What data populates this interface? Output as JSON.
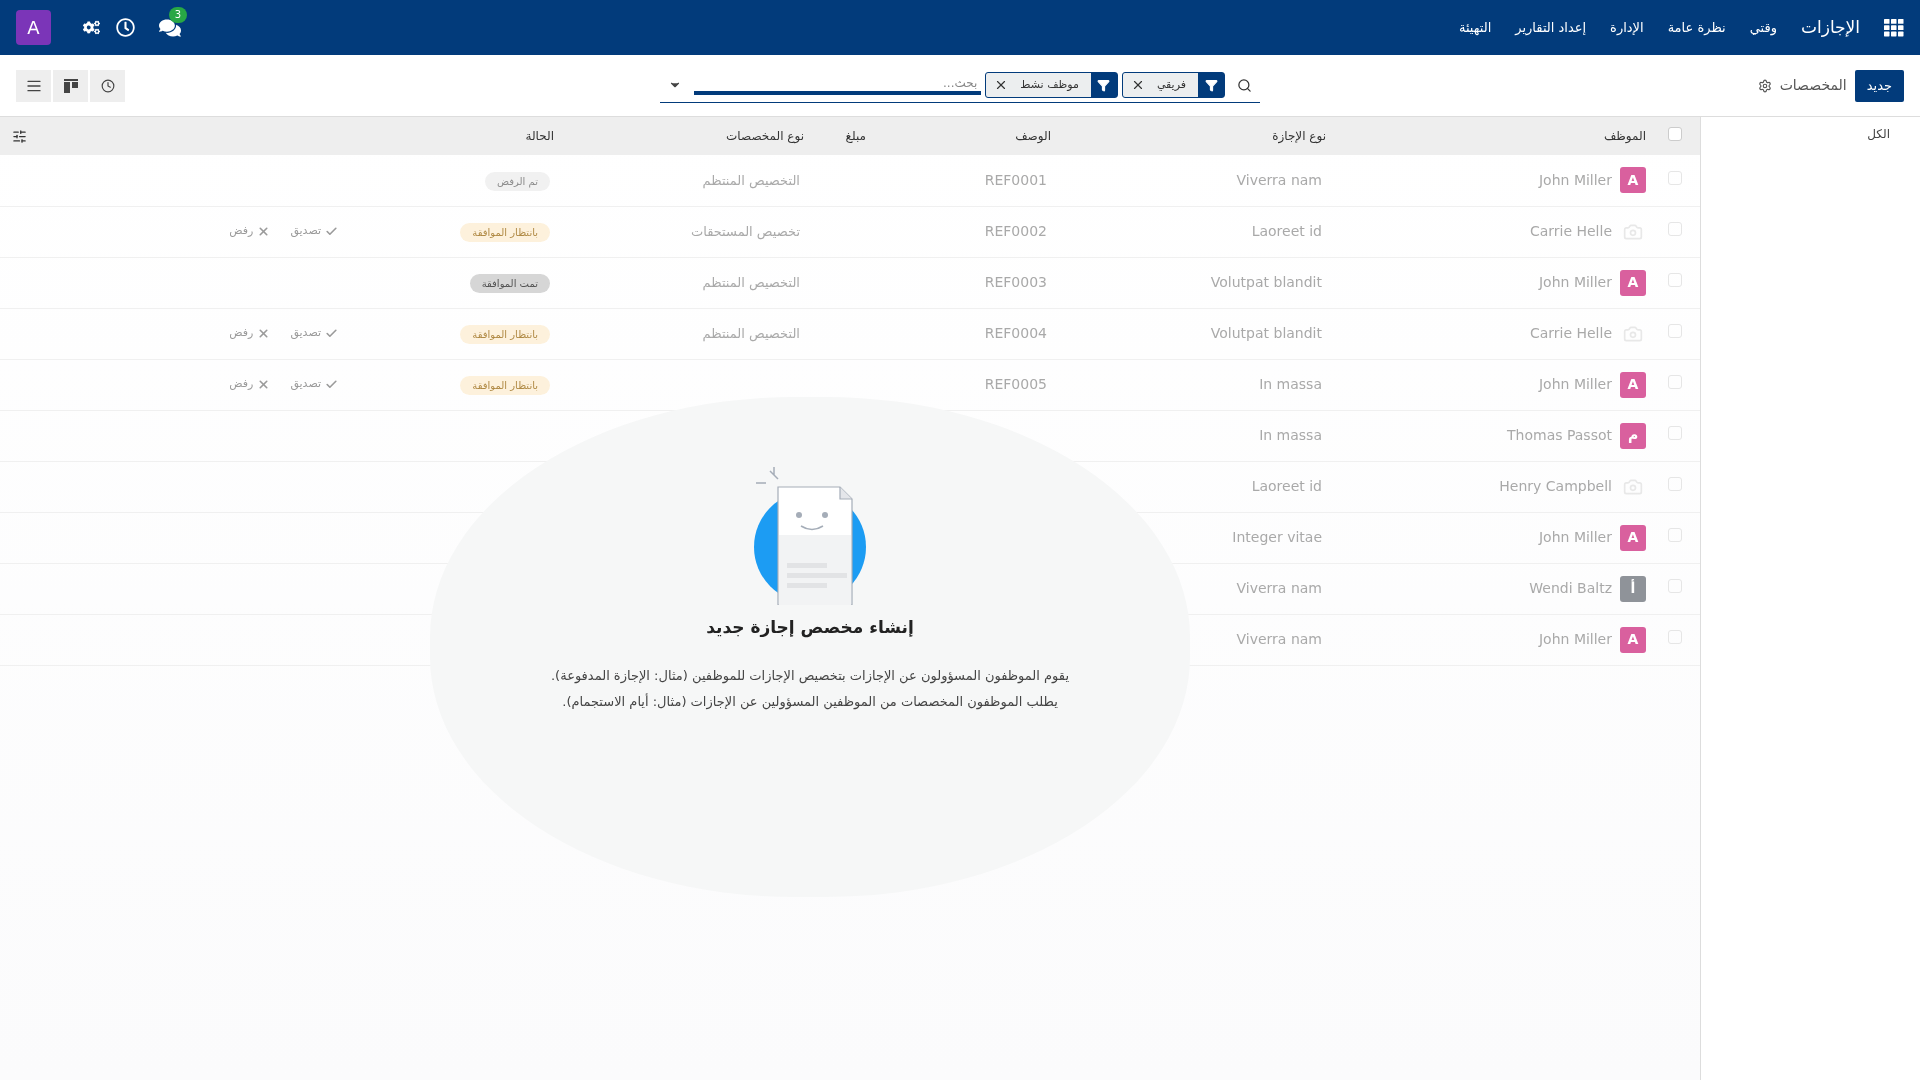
{
  "navbar": {
    "brand": "الإجازات",
    "menu": [
      "وقتي",
      "نظرة عامة",
      "الإدارة",
      "إعداد التقارير",
      "التهيئة"
    ],
    "messages_badge": "3",
    "user_avatar": "A"
  },
  "control_panel": {
    "new_button": "جديد",
    "breadcrumb": "المخصصات",
    "search": {
      "facets": [
        {
          "kind": "filter",
          "label": "فريقي"
        },
        {
          "kind": "filter",
          "label": "موظف نشط"
        }
      ],
      "placeholder": "بحث..."
    }
  },
  "sidebar": {
    "items": [
      {
        "label": "الكل"
      }
    ]
  },
  "table": {
    "columns": [
      "الموظف",
      "نوع الإجازة",
      "الوصف",
      "مبلغ",
      "نوع المخصصات",
      "الحالة"
    ],
    "select_all_checked": false,
    "rows": [
      {
        "checked": false,
        "employee": "John Miller",
        "avatar": {
          "kind": "letter",
          "letter": "A",
          "color": "#d9609e"
        },
        "leave_type": "Viverra nam",
        "description": "REF0001",
        "allocation_type": "التخصيص المنتظم",
        "status": {
          "kind": "refused",
          "label": "تم الرفض"
        },
        "actions": []
      },
      {
        "checked": false,
        "employee": "Carrie Helle",
        "avatar": {
          "kind": "camera"
        },
        "leave_type": "Laoreet id",
        "description": "REF0002",
        "allocation_type": "تخصيص المستحقات",
        "status": {
          "kind": "waiting",
          "label": "بانتظار الموافقة"
        },
        "actions": [
          {
            "kind": "approve",
            "label": "تصديق"
          },
          {
            "kind": "refuse",
            "label": "رفض"
          }
        ]
      },
      {
        "checked": false,
        "employee": "John Miller",
        "avatar": {
          "kind": "letter",
          "letter": "A",
          "color": "#d9609e"
        },
        "leave_type": "Volutpat blandit",
        "description": "REF0003",
        "allocation_type": "التخصيص المنتظم",
        "status": {
          "kind": "approved",
          "label": "تمت الموافقة"
        },
        "actions": []
      },
      {
        "checked": false,
        "employee": "Carrie Helle",
        "avatar": {
          "kind": "camera"
        },
        "leave_type": "Volutpat blandit",
        "description": "REF0004",
        "allocation_type": "التخصيص المنتظم",
        "status": {
          "kind": "waiting",
          "label": "بانتظار الموافقة"
        },
        "actions": [
          {
            "kind": "approve",
            "label": "تصديق"
          },
          {
            "kind": "refuse",
            "label": "رفض"
          }
        ]
      },
      {
        "checked": false,
        "employee": "John Miller",
        "avatar": {
          "kind": "letter",
          "letter": "A",
          "color": "#d9609e"
        },
        "leave_type": "In massa",
        "description": "REF0005",
        "status": {
          "kind": "waiting",
          "label": "بانتظار الموافقة"
        },
        "actions": [
          {
            "kind": "approve",
            "label": "تصديق"
          },
          {
            "kind": "refuse",
            "label": "رفض"
          }
        ]
      },
      {
        "checked": false,
        "employee": "Thomas Passot",
        "avatar": {
          "kind": "letter",
          "letter": "م",
          "color": "#d9609e"
        },
        "leave_type": "In massa",
        "actions": []
      },
      {
        "checked": false,
        "employee": "Henry Campbell",
        "avatar": {
          "kind": "camera"
        },
        "leave_type": "Laoreet id",
        "actions": []
      },
      {
        "checked": false,
        "employee": "John Miller",
        "avatar": {
          "kind": "letter",
          "letter": "A",
          "color": "#d9609e"
        },
        "leave_type": "Integer vitae",
        "actions": []
      },
      {
        "checked": false,
        "employee": "Wendi Baltz",
        "avatar": {
          "kind": "letter",
          "letter": "أ",
          "color": "#8f9399"
        },
        "leave_type": "Viverra nam",
        "actions": []
      },
      {
        "checked": false,
        "employee": "John Miller",
        "avatar": {
          "kind": "letter",
          "letter": "A",
          "color": "#d9609e"
        },
        "leave_type": "Viverra nam",
        "actions": []
      }
    ]
  },
  "empty_state": {
    "title": "إنشاء مخصص إجازة جديد",
    "lines": [
      "يقوم الموظفون المسؤولون عن الإجازات بتخصيص الإجازات للموظفين (مثال: الإجازة المدفوعة).",
      "يطلب الموظفون المخصصات من الموظفين المسؤولين عن الإجازات (مثال: أيام الاستجمام)."
    ]
  }
}
